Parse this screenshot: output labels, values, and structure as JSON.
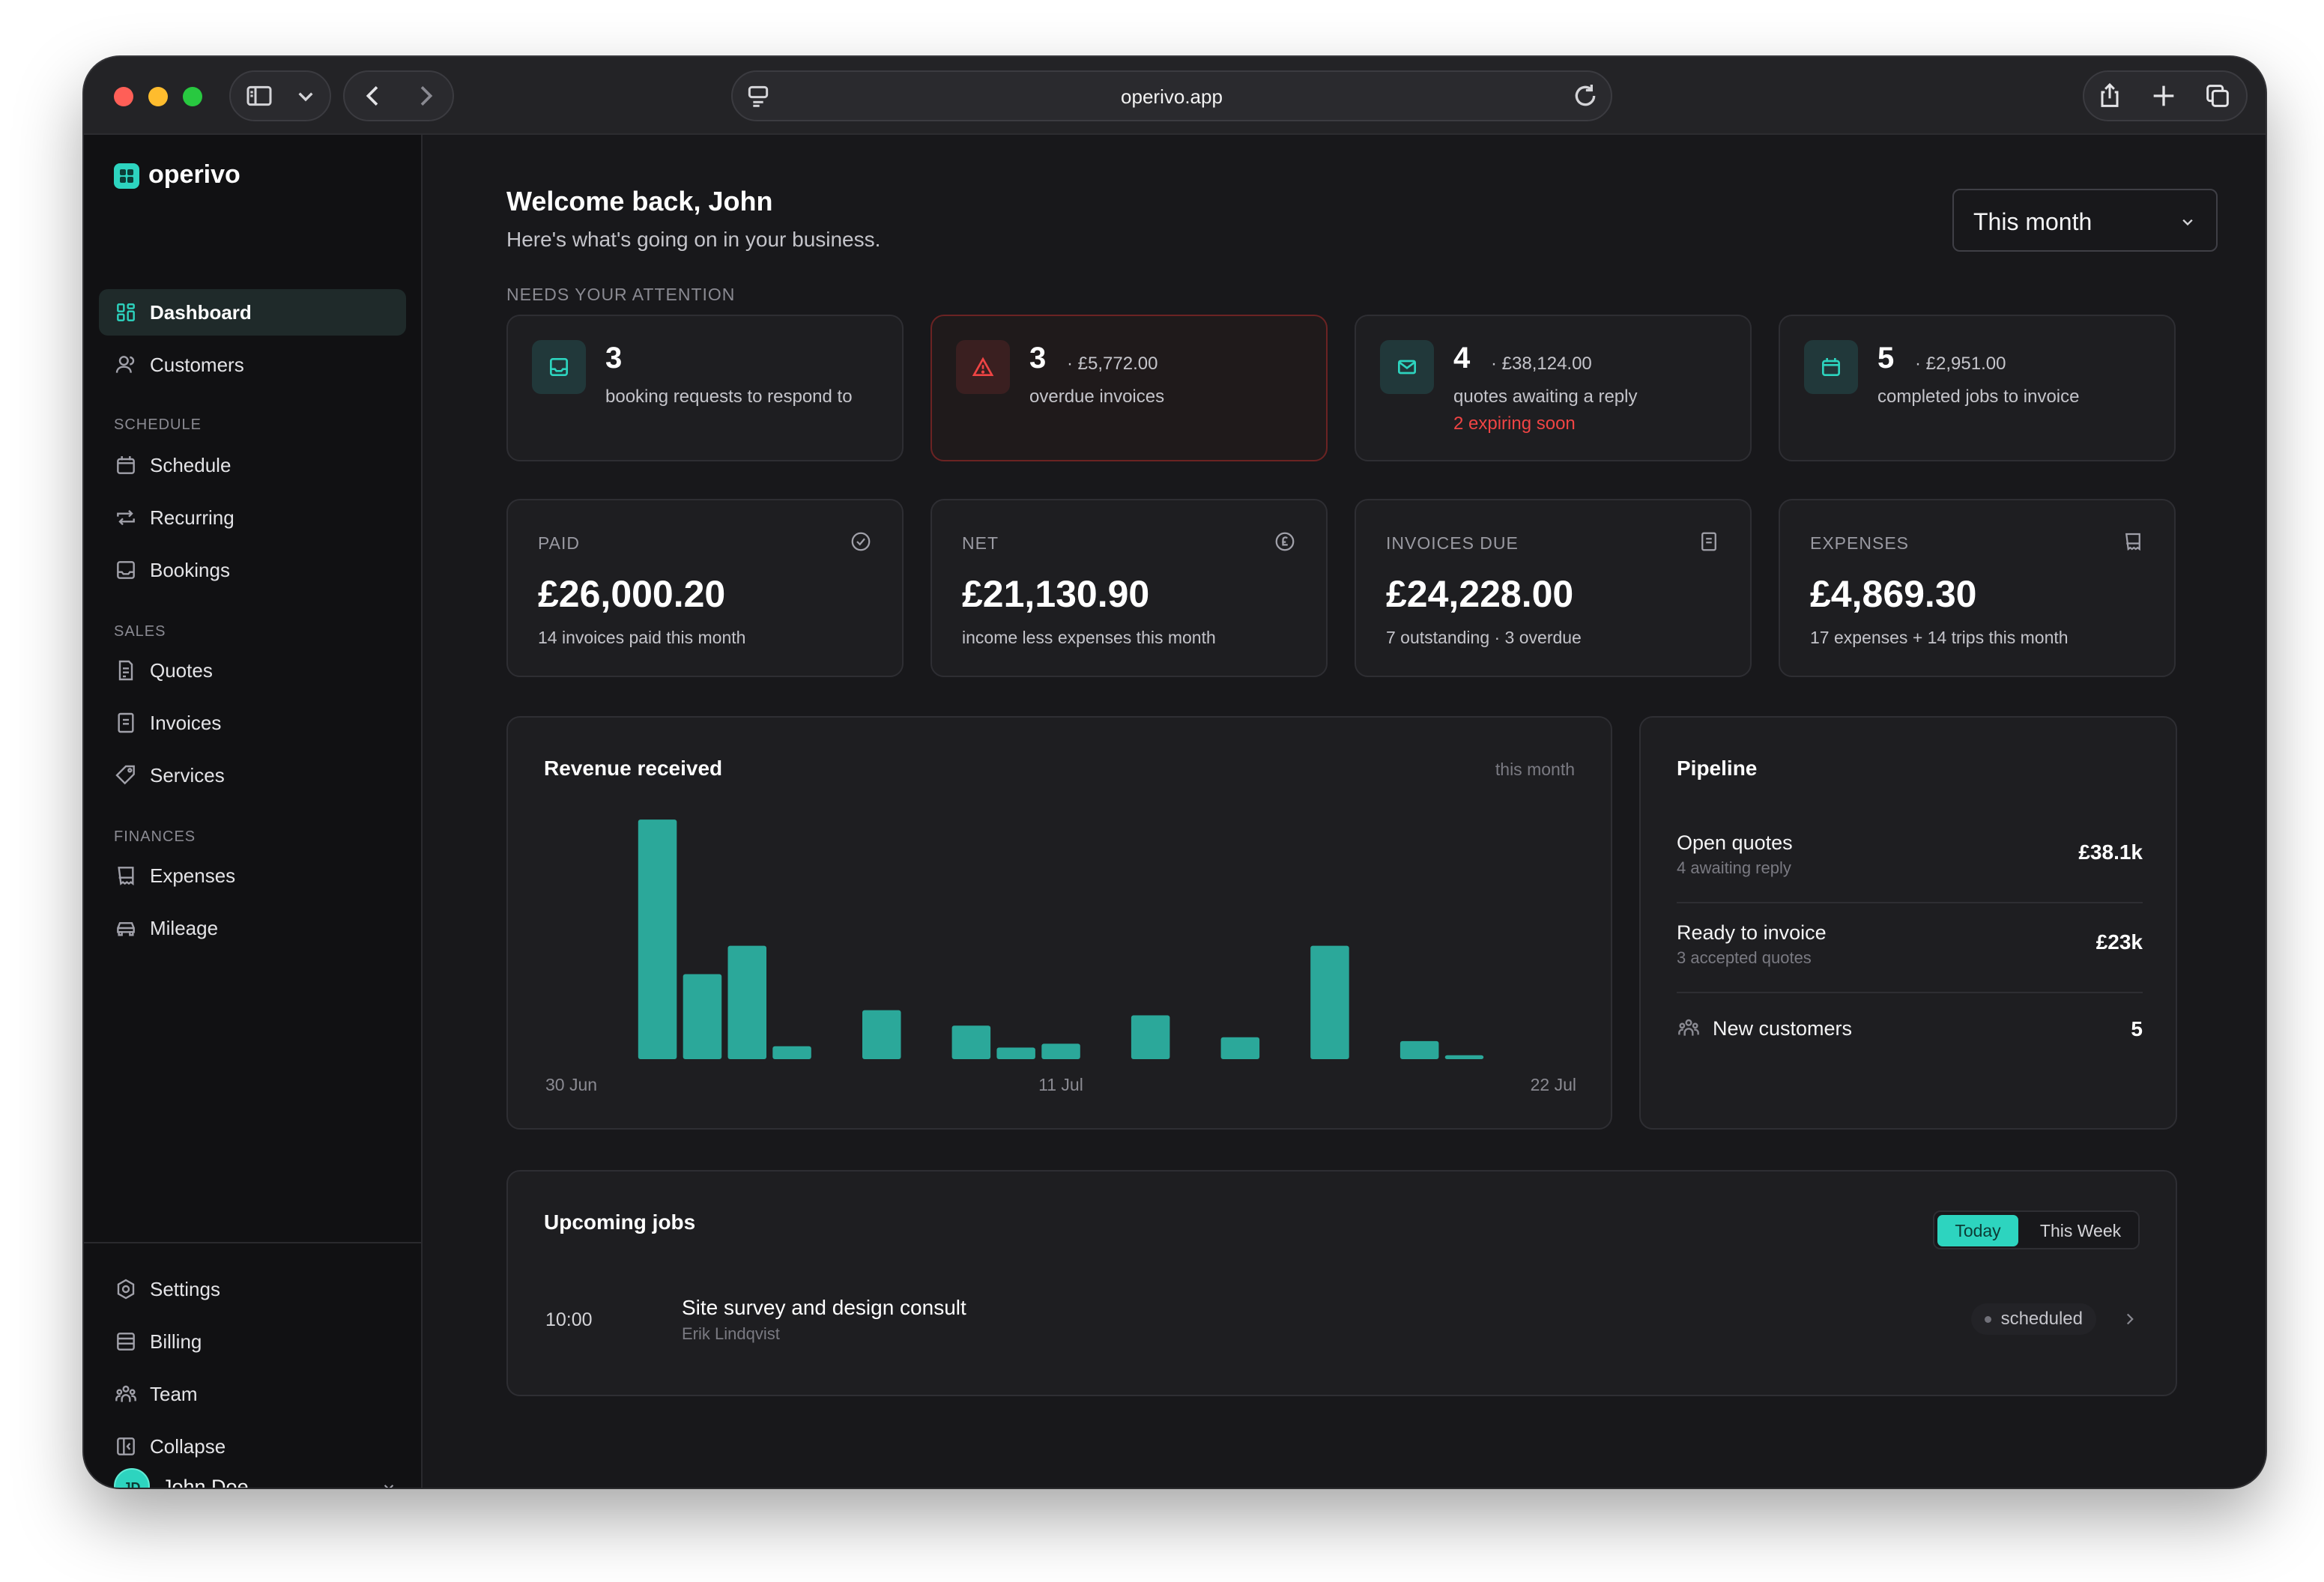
{
  "browser": {
    "url": "operivo.app"
  },
  "sidebar": {
    "brand": "operivo",
    "top_items": [
      {
        "label": "Dashboard",
        "icon": "dashboard-icon"
      },
      {
        "label": "Customers",
        "icon": "customers-icon"
      }
    ],
    "sections": [
      {
        "title": "SCHEDULE",
        "items": [
          {
            "label": "Schedule",
            "icon": "calendar-icon"
          },
          {
            "label": "Recurring",
            "icon": "repeat-icon"
          },
          {
            "label": "Bookings",
            "icon": "inbox-icon"
          }
        ]
      },
      {
        "title": "SALES",
        "items": [
          {
            "label": "Quotes",
            "icon": "quote-doc-icon"
          },
          {
            "label": "Invoices",
            "icon": "invoice-icon"
          },
          {
            "label": "Services",
            "icon": "tag-icon"
          }
        ]
      },
      {
        "title": "FINANCES",
        "items": [
          {
            "label": "Expenses",
            "icon": "receipt-icon"
          },
          {
            "label": "Mileage",
            "icon": "car-icon"
          }
        ]
      }
    ],
    "bottom_items": [
      {
        "label": "Settings",
        "icon": "gear-icon"
      },
      {
        "label": "Billing",
        "icon": "billing-icon"
      },
      {
        "label": "Team",
        "icon": "team-icon"
      },
      {
        "label": "Collapse",
        "icon": "collapse-icon"
      }
    ],
    "user": {
      "initials": "JD",
      "name": "John Doe"
    }
  },
  "header": {
    "title": "Welcome back, John",
    "subtitle": "Here's what's going on in your business.",
    "range_select": "This month"
  },
  "attention": {
    "label": "NEEDS YOUR ATTENTION",
    "cards": [
      {
        "count": "3",
        "amount": "",
        "desc": "booking requests to respond to",
        "warning": "",
        "icon": "inbox-icon"
      },
      {
        "count": "3",
        "amount": "· £5,772.00",
        "desc": "overdue invoices",
        "warning": "",
        "icon": "warning-triangle-icon"
      },
      {
        "count": "4",
        "amount": "· £38,124.00",
        "desc": "quotes awaiting a reply",
        "warning": "2 expiring soon",
        "icon": "mail-icon"
      },
      {
        "count": "5",
        "amount": "· £2,951.00",
        "desc": "completed jobs to invoice",
        "warning": "",
        "icon": "calendar-icon"
      }
    ]
  },
  "stats": [
    {
      "label": "PAID",
      "value": "£26,000.20",
      "sub": "14 invoices paid this month",
      "icon": "check-circle-icon"
    },
    {
      "label": "NET",
      "value": "£21,130.90",
      "sub": "income less expenses this month",
      "icon": "pound-circle-icon"
    },
    {
      "label": "INVOICES DUE",
      "value": "£24,228.00",
      "sub": "7 outstanding · 3 overdue",
      "icon": "document-icon"
    },
    {
      "label": "EXPENSES",
      "value": "£4,869.30",
      "sub": "17 expenses + 14 trips this month",
      "icon": "receipt-icon"
    }
  ],
  "revenue": {
    "title": "Revenue received",
    "note": "this month"
  },
  "chart_data": {
    "type": "bar",
    "title": "Revenue received",
    "x_tick_labels": [
      "30 Jun",
      "11 Jul",
      "22 Jul"
    ],
    "categories": [
      "30 Jun",
      "1 Jul",
      "2 Jul",
      "3 Jul",
      "4 Jul",
      "5 Jul",
      "6 Jul",
      "7 Jul",
      "8 Jul",
      "9 Jul",
      "10 Jul",
      "11 Jul",
      "12 Jul",
      "13 Jul",
      "14 Jul",
      "15 Jul",
      "16 Jul",
      "17 Jul",
      "18 Jul",
      "19 Jul",
      "20 Jul",
      "21 Jul",
      "22 Jul"
    ],
    "values": [
      0,
      0,
      9.3,
      3.3,
      4.4,
      0.5,
      0,
      1.9,
      0,
      1.3,
      0.45,
      0.6,
      0,
      1.7,
      0,
      0.85,
      0,
      4.4,
      0,
      0.7,
      0.15,
      0,
      0
    ],
    "ylim": [
      0,
      10
    ],
    "grid": false,
    "color": "#2ba89a"
  },
  "pipeline": {
    "title": "Pipeline",
    "rows": [
      {
        "title": "Open quotes",
        "sub": "4 awaiting reply",
        "value": "£38.1k"
      },
      {
        "title": "Ready to invoice",
        "sub": "3 accepted quotes",
        "value": "£23k"
      }
    ],
    "customers": {
      "title": "New customers",
      "value": "5",
      "icon": "people-icon"
    }
  },
  "jobs": {
    "title": "Upcoming jobs",
    "tabs": [
      "Today",
      "This Week"
    ],
    "active_tab": "Today",
    "items": [
      {
        "time": "10:00",
        "title": "Site survey and design consult",
        "customer": "Erik Lindqvist",
        "status": "scheduled"
      }
    ]
  },
  "colors": {
    "accent": "#2dd4bf",
    "bar": "#2ba89a",
    "danger": "#ef4444",
    "background": "#18181b",
    "card": "#1e1e21"
  }
}
